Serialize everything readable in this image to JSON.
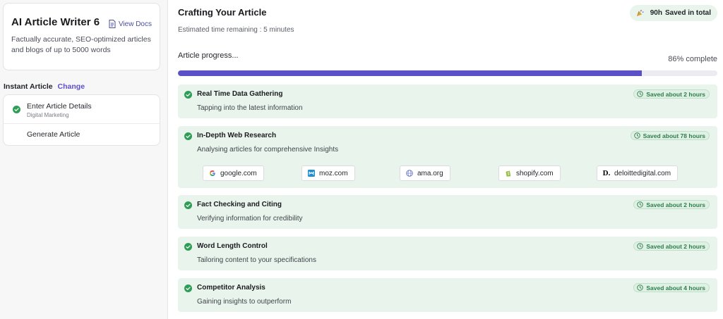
{
  "sidebar": {
    "app_title": "AI Article Writer 6",
    "view_docs_label": "View Docs",
    "app_description": "Factually accurate, SEO-optimized articles and blogs of up to 5000 words",
    "mode_label": "Instant Article",
    "change_label": "Change",
    "steps": [
      {
        "label": "Enter Article Details",
        "sub": "Digital Marketing",
        "done": true
      },
      {
        "label": "Generate Article",
        "sub": "",
        "done": false
      }
    ]
  },
  "main": {
    "title": "Crafting Your Article",
    "eta": "Estimated time remaining : 5 minutes",
    "saved_hours": "90h",
    "saved_label": "Saved in total",
    "progress_label": "Article progress...",
    "progress_text": "86% complete",
    "progress_fraction": 0.86,
    "tasks": [
      {
        "title": "Real Time Data Gathering",
        "desc": "Tapping into the latest information",
        "badge": "Saved about 2 hours"
      },
      {
        "title": "In-Depth Web Research",
        "desc": "Analysing articles for comprehensive Insights",
        "badge": "Saved about 78 hours",
        "sources": [
          {
            "name": "google.com",
            "icon": "google-icon"
          },
          {
            "name": "moz.com",
            "icon": "moz-icon"
          },
          {
            "name": "ama.org",
            "icon": "ama-icon"
          },
          {
            "name": "shopify.com",
            "icon": "shopify-icon"
          },
          {
            "name": "deloittedigital.com",
            "icon": "deloitte-icon"
          }
        ]
      },
      {
        "title": "Fact Checking and Citing",
        "desc": "Verifying information for credibility",
        "badge": "Saved about 2 hours"
      },
      {
        "title": "Word Length Control",
        "desc": "Tailoring content to your specifications",
        "badge": "Saved about 2 hours"
      },
      {
        "title": "Competitor Analysis",
        "desc": "Gaining insights to outperform",
        "badge": "Saved about 4 hours"
      }
    ]
  },
  "colors": {
    "accent": "#5b50c8",
    "success": "#2e9e57",
    "task_bg": "#e9f5ec"
  }
}
